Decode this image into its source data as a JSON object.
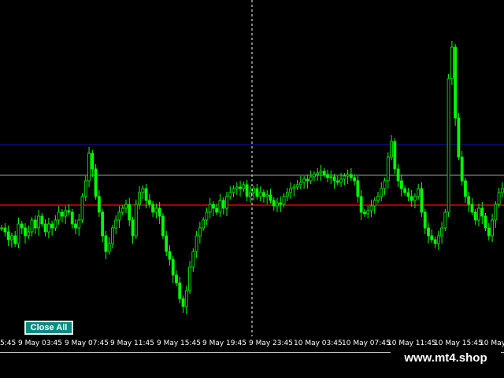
{
  "toolbar": {
    "close_all_label": "Close All"
  },
  "watermark": "www.mt4.shop",
  "colors": {
    "background": "#000000",
    "candle": "#00ff00",
    "level_blue": "#1010c0",
    "level_gray": "#a0a0a0",
    "level_red": "#e00000",
    "crosshair": "#ffffff",
    "button": "#0b8a84"
  },
  "time_axis": [
    "5:45",
    "9 May 03:45",
    "9 May 07:45",
    "9 May 11:45",
    "9 May 15:45",
    "9 May 19:45",
    "9 May 23:45",
    "10 May 03:45",
    "10 May 07:45",
    "10 May 11:45",
    "10 May 15:45",
    "10 May"
  ],
  "chart_data": {
    "type": "candlestick",
    "price_levels": [
      {
        "name": "level-blue",
        "color": "#1010c0",
        "value": 184
      },
      {
        "name": "level-gray",
        "color": "#a0a0a0",
        "value": 223
      },
      {
        "name": "level-red",
        "color": "#e00000",
        "value": 261
      }
    ],
    "close_series": [
      290,
      295,
      305,
      300,
      310,
      285,
      290,
      300,
      295,
      280,
      290,
      275,
      285,
      295,
      285,
      290,
      280,
      270,
      275,
      268,
      270,
      285,
      290,
      280,
      250,
      230,
      195,
      215,
      250,
      270,
      300,
      320,
      310,
      290,
      280,
      270,
      265,
      260,
      280,
      300,
      260,
      245,
      240,
      255,
      260,
      270,
      265,
      275,
      300,
      320,
      330,
      350,
      360,
      380,
      390,
      370,
      340,
      320,
      300,
      290,
      280,
      270,
      260,
      265,
      270,
      255,
      265,
      250,
      245,
      240,
      238,
      240,
      235,
      250,
      245,
      240,
      250,
      245,
      250,
      248,
      255,
      262,
      258,
      260,
      250,
      245,
      240,
      238,
      235,
      232,
      228,
      230,
      225,
      222,
      220,
      218,
      222,
      226,
      225,
      230,
      232,
      228,
      224,
      222,
      226,
      230,
      250,
      270,
      272,
      268,
      262,
      255,
      250,
      240,
      230,
      200,
      180,
      215,
      230,
      240,
      245,
      250,
      255,
      250,
      240,
      270,
      290,
      300,
      305,
      310,
      300,
      290,
      270,
      100,
      60,
      150,
      200,
      230,
      250,
      260,
      270,
      280,
      265,
      275,
      290,
      300,
      280,
      260,
      245,
      240
    ]
  }
}
